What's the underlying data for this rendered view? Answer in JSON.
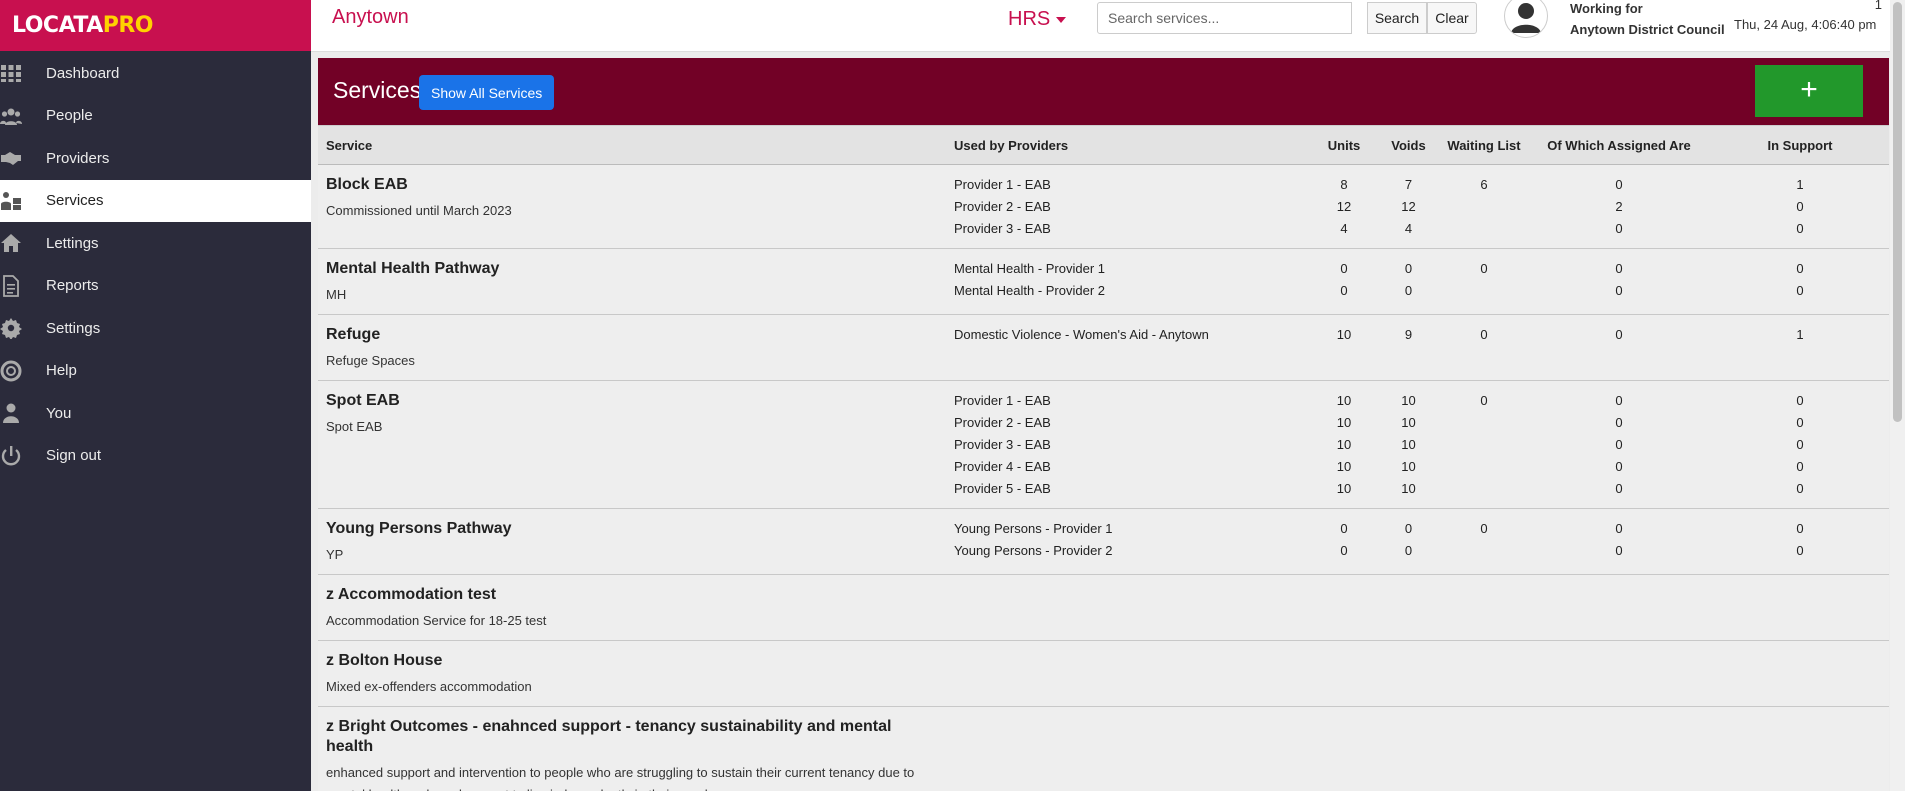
{
  "brand": {
    "logo_main": "LOCATA",
    "logo_accent": "PRO"
  },
  "sidebar": {
    "items": [
      {
        "label": "Dashboard",
        "icon": "grid-icon"
      },
      {
        "label": "People",
        "icon": "people-icon"
      },
      {
        "label": "Providers",
        "icon": "handshake-icon"
      },
      {
        "label": "Services",
        "icon": "services-icon",
        "active": true
      },
      {
        "label": "Lettings",
        "icon": "home-icon"
      },
      {
        "label": "Reports",
        "icon": "document-icon"
      },
      {
        "label": "Settings",
        "icon": "gear-icon"
      },
      {
        "label": "Help",
        "icon": "lifebuoy-icon"
      },
      {
        "label": "You",
        "icon": "user-icon"
      },
      {
        "label": "Sign out",
        "icon": "power-icon"
      }
    ]
  },
  "header": {
    "title": "Anytown",
    "module": "HRS",
    "search_placeholder": "Search services...",
    "search_label": "Search",
    "clear_label": "Clear",
    "working_for_label": "Working for",
    "organisation": "Anytown District Council",
    "datetime": "Thu, 24 Aug, 4:06:40 pm",
    "corner_number": "1"
  },
  "panel": {
    "title": "Services",
    "show_all_label": "Show All Services",
    "add_label": "+"
  },
  "table": {
    "columns": [
      "Service",
      "Used by Providers",
      "Units",
      "Voids",
      "Waiting List",
      "Of Which Assigned Are",
      "In Support"
    ],
    "rows": [
      {
        "name": "Block EAB",
        "desc": "Commissioned until March 2023",
        "providers": [
          "Provider 1 - EAB",
          "Provider 2 - EAB",
          "Provider 3 - EAB"
        ],
        "units": [
          "8",
          "12",
          "4"
        ],
        "voids": [
          "7",
          "12",
          "4"
        ],
        "waiting": [
          "6"
        ],
        "assigned": [
          "0",
          "2",
          "0"
        ],
        "support": [
          "1",
          "0",
          "0"
        ]
      },
      {
        "name": "Mental Health Pathway",
        "desc": "MH",
        "providers": [
          "Mental Health - Provider 1",
          "Mental Health - Provider 2"
        ],
        "units": [
          "0",
          "0"
        ],
        "voids": [
          "0",
          "0"
        ],
        "waiting": [
          "0"
        ],
        "assigned": [
          "0",
          "0"
        ],
        "support": [
          "0",
          "0"
        ]
      },
      {
        "name": "Refuge",
        "desc": "Refuge Spaces",
        "providers": [
          "Domestic Violence - Women's Aid - Anytown"
        ],
        "units": [
          "10"
        ],
        "voids": [
          "9"
        ],
        "waiting": [
          "0"
        ],
        "assigned": [
          "0"
        ],
        "support": [
          "1"
        ]
      },
      {
        "name": "Spot EAB",
        "desc": "Spot EAB",
        "providers": [
          "Provider 1 - EAB",
          "Provider 2 - EAB",
          "Provider 3 - EAB",
          "Provider 4 - EAB",
          "Provider 5 - EAB"
        ],
        "units": [
          "10",
          "10",
          "10",
          "10",
          "10"
        ],
        "voids": [
          "10",
          "10",
          "10",
          "10",
          "10"
        ],
        "waiting": [
          "0"
        ],
        "assigned": [
          "0",
          "0",
          "0",
          "0",
          "0"
        ],
        "support": [
          "0",
          "0",
          "0",
          "0",
          "0"
        ]
      },
      {
        "name": "Young Persons Pathway",
        "desc": "YP",
        "providers": [
          "Young Persons - Provider 1",
          "Young Persons - Provider 2"
        ],
        "units": [
          "0",
          "0"
        ],
        "voids": [
          "0",
          "0"
        ],
        "waiting": [
          "0"
        ],
        "assigned": [
          "0",
          "0"
        ],
        "support": [
          "0",
          "0"
        ]
      },
      {
        "name": "z Accommodation test",
        "desc": "Accommodation Service for 18-25 test",
        "providers": [],
        "units": [],
        "voids": [],
        "waiting": [],
        "assigned": [],
        "support": []
      },
      {
        "name": "z Bolton House",
        "desc": "Mixed ex-offenders accommodation",
        "providers": [],
        "units": [],
        "voids": [],
        "waiting": [],
        "assigned": [],
        "support": []
      },
      {
        "name": "z Bright Outcomes - enahnced support - tenancy sustainability and mental health",
        "desc": "enhanced support and intervention to people who are struggling to sustain their current tenancy due to mental health and need support to live independently in their own home.",
        "providers": [],
        "units": [],
        "voids": [],
        "waiting": [],
        "assigned": [],
        "support": []
      }
    ]
  },
  "colors": {
    "brand": "#c8104f",
    "panel_header": "#720126",
    "sidebar": "#2b2b3b",
    "show_all_button": "#1a73e8",
    "add_button": "#22982b"
  }
}
